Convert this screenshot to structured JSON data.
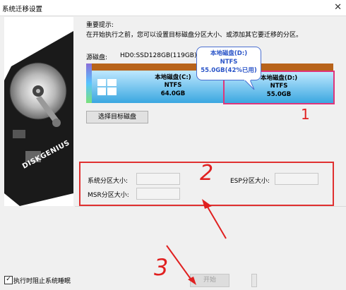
{
  "window": {
    "title": "系统迁移设置"
  },
  "tip": {
    "title": "重要提示:",
    "text": "在开始执行之前，您可以设置目标磁盘分区大小、或添加其它要迁移的分区。"
  },
  "source": {
    "label": "源磁盘:",
    "disk": "HD0:SSD128GB(119GB)"
  },
  "partitions": [
    {
      "name": "本地磁盘(C:)",
      "fs": "NTFS",
      "size": "64.0GB"
    },
    {
      "name": "本地磁盘(D:)",
      "fs": "NTFS",
      "size": "55.0GB"
    }
  ],
  "tooltip": {
    "name": "本地磁盘(D:)",
    "fs": "NTFS",
    "usage": "55.0GB(42%已用)"
  },
  "select_target_button": "选择目标磁盘",
  "fields": {
    "system_label": "系统分区大小:",
    "esp_label": "ESP分区大小:",
    "msr_label": "MSR分区大小:"
  },
  "sidebar_brand": "DISKGENIUS",
  "checkbox": {
    "label": "执行时阻止系统睡眠",
    "checked": true,
    "mark": "✓"
  },
  "start_button": "开始",
  "annotations": {
    "n1": "1",
    "n2": "2",
    "n3": "3"
  },
  "colors": {
    "accent": "#2b55c8",
    "annotation": "#e02020",
    "disk_top": "#b8631a",
    "disk_body": "#3aa7e0"
  }
}
